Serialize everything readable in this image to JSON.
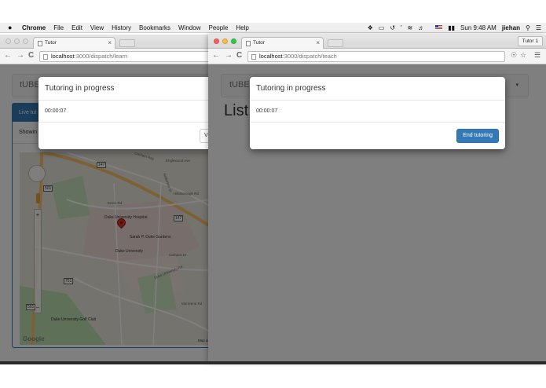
{
  "menubar": {
    "apple": "",
    "items": [
      "Chrome",
      "File",
      "Edit",
      "View",
      "History",
      "Bookmarks",
      "Window",
      "People",
      "Help"
    ],
    "clock": "Sun 9:48 AM",
    "user": "jiehan"
  },
  "left_window": {
    "tab_title": "Tutor",
    "url_host": "localhost",
    "url_path": ":3000/dispatch/learn",
    "brand": "tUBE",
    "panel_heading": "Live tut",
    "panel_sub": "Showin",
    "modal": {
      "title": "Tutoring in progress",
      "timer": "00:00:07",
      "ghost_button": "V"
    },
    "map": {
      "labels": [
        "Duke University Hospital",
        "Sarah P. Duke Gardens",
        "Duke University",
        "Duke University Golf Club",
        "Erwin Rd",
        "Hillsborough Rd",
        "Englewood Ave",
        "Durham Fwy",
        "Duke University Rd",
        "Anderson St",
        "Campus Dr",
        "Morreene Rd"
      ],
      "shields": [
        "147",
        "501",
        "751"
      ],
      "attribution": "Google",
      "data_note": "Map da"
    }
  },
  "right_window": {
    "tab_title": "Tutor",
    "profile": "Tutor 1",
    "url_host": "localhost",
    "url_path": ":3000/dispatch/teach",
    "brand": "tUBE",
    "heading": "List",
    "modal": {
      "title": "Tutoring in progress",
      "timer": "00:00:07",
      "end_button": "End tutoring"
    }
  },
  "colors": {
    "primary": "#337ab7",
    "backdrop": "rgba(0,0,0,0.5)",
    "marker": "#d9352b"
  }
}
